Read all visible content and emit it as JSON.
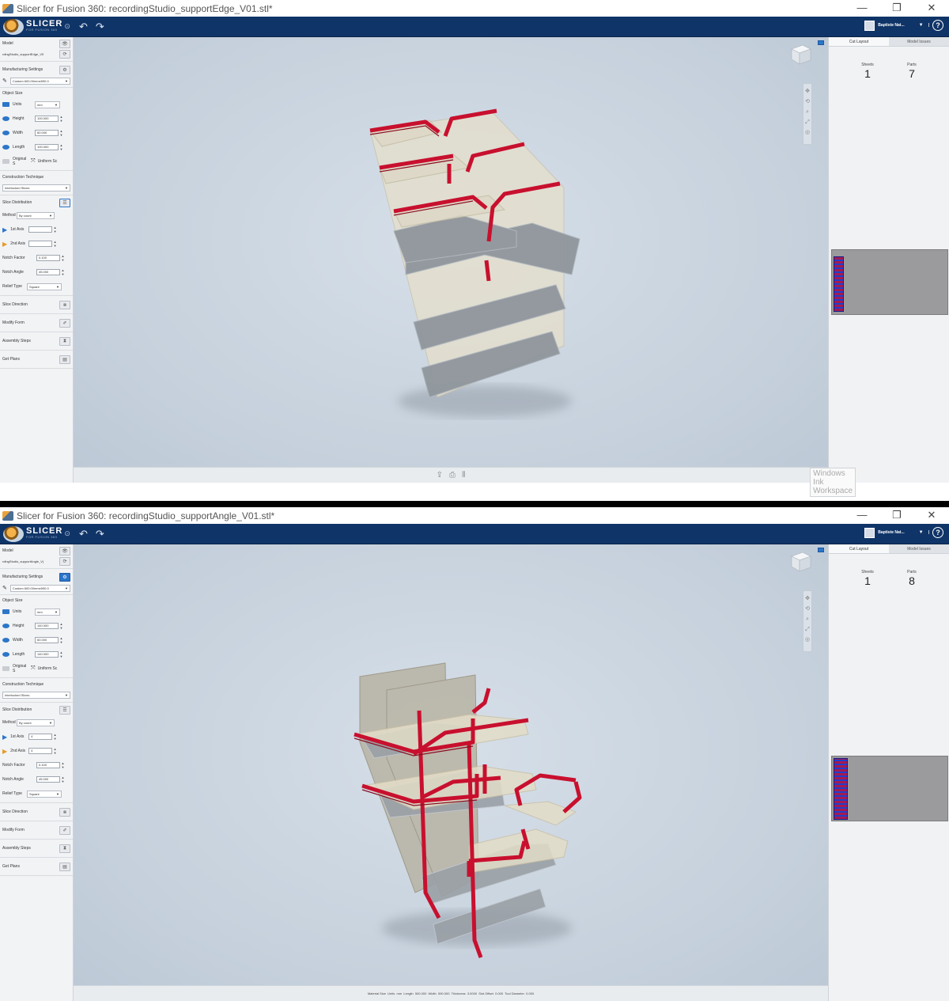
{
  "windows": [
    {
      "title": "Slicer for Fusion 360: recordingStudio_supportEdge_V01.stl*",
      "user": "Baptiste Nat...",
      "model_file": "rdingStudio_supportEdge_V0",
      "manufacturing": "Custom 600.00mmx590.0",
      "units": "mm",
      "height": "100.000",
      "width": "60.000",
      "length": "100.000",
      "notch_factor": "0.100",
      "notch_angle": "45.000",
      "axis1": "",
      "axis2": "",
      "sheets": "1",
      "parts": "7",
      "footer": ""
    },
    {
      "title": "Slicer for Fusion 360: recordingStudio_supportAngle_V01.stl*",
      "user": "Baptiste Nat...",
      "model_file": "rdingStudio_supportAngle_V(",
      "manufacturing": "Custom 600.00mmx590.0",
      "units": "mm",
      "height": "140.000",
      "width": "60.000",
      "length": "140.000",
      "notch_factor": "0.100",
      "notch_angle": "45.000",
      "axis1": "4",
      "axis2": "4",
      "sheets": "1",
      "parts": "8",
      "footer": "Material Size  Units  mm  Length  500.000  Width  590.000  Thickness  3.0000  Slot Offset  0.000  Tool Diameter  0.000"
    }
  ],
  "labels": {
    "model": "Model",
    "manufacturing_settings": "Manufacturing Settings",
    "object_size": "Object Size",
    "units": "Units",
    "height": "Height",
    "width": "Width",
    "length": "Length",
    "original_scale": "Original S",
    "uniform_scale": "Uniform Sc",
    "construction_technique": "Construction Technique",
    "technique_value": "Interlocked Slices",
    "slice_distribution": "Slice Distribution",
    "method": "Method",
    "method_value": "By count",
    "axis1": "1st Axis",
    "axis2": "2nd Axis",
    "notch_factor": "Notch Factor",
    "notch_angle": "Notch Angle",
    "relief_type": "Relief Type",
    "relief_value": "Square",
    "slice_direction": "Slice Direction",
    "modify_form": "Modify Form",
    "assembly_steps": "Assembly Steps",
    "get_plans": "Get Plans",
    "tab_cut": "Cut Layout",
    "tab_issues": "Model Issues",
    "sheets": "Sheets",
    "parts": "Parts",
    "logo": "SLICER",
    "logo_sub": "FOR FUSION 360",
    "ink": "Windows Ink Workspace"
  },
  "colors": {
    "accent": "#0f3468",
    "slice_edge": "#c8102e",
    "panel": "#e8e1cf"
  }
}
